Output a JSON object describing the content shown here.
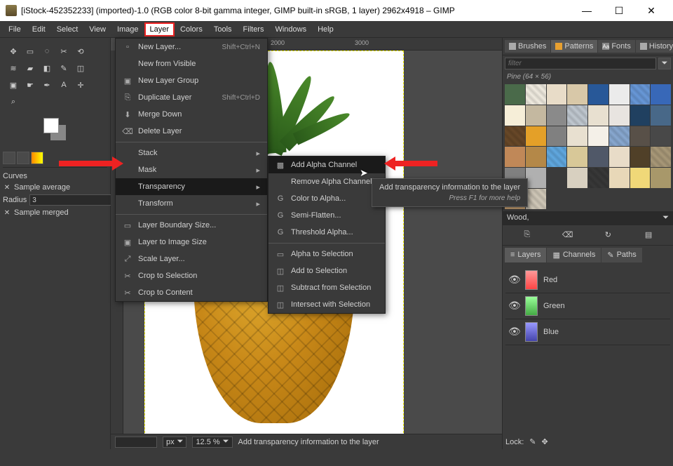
{
  "window": {
    "title": "[iStock-452352233] (imported)-1.0 (RGB color 8-bit gamma integer, GIMP built-in sRGB, 1 layer) 2962x4918 – GIMP"
  },
  "menubar": [
    "File",
    "Edit",
    "Select",
    "View",
    "Image",
    "Layer",
    "Colors",
    "Tools",
    "Filters",
    "Windows",
    "Help"
  ],
  "active_menu_index": 5,
  "layer_menu": {
    "new_layer": "New Layer...",
    "new_layer_sc": "Shift+Ctrl+N",
    "new_from_visible": "New from Visible",
    "new_group": "New Layer Group",
    "duplicate": "Duplicate Layer",
    "duplicate_sc": "Shift+Ctrl+D",
    "merge_down": "Merge Down",
    "delete": "Delete Layer",
    "stack": "Stack",
    "mask": "Mask",
    "transparency": "Transparency",
    "transform": "Transform",
    "boundary": "Layer Boundary Size...",
    "to_image": "Layer to Image Size",
    "scale": "Scale Layer...",
    "crop_sel": "Crop to Selection",
    "crop_content": "Crop to Content"
  },
  "transparency_menu": {
    "add_alpha": "Add Alpha Channel",
    "remove_alpha": "Remove Alpha Channel",
    "color_to_alpha": "Color to Alpha...",
    "semi_flatten": "Semi-Flatten...",
    "threshold": "Threshold Alpha...",
    "alpha_to_sel": "Alpha to Selection",
    "add_to_sel": "Add to Selection",
    "sub_from_sel": "Subtract from Selection",
    "intersect": "Intersect with Selection"
  },
  "tooltip": {
    "text": "Add transparency information to the layer",
    "help": "Press F1 for more help"
  },
  "left_panel": {
    "curves": "Curves",
    "sample_avg": "Sample average",
    "radius": "Radius",
    "radius_val": "3",
    "sample_merged": "Sample merged"
  },
  "ruler": {
    "t1": "2000",
    "t2": "3000"
  },
  "status": {
    "unit": "px",
    "zoom": "12.5 %",
    "msg": "Add transparency information to the layer"
  },
  "right": {
    "tabs": {
      "brushes": "Brushes",
      "patterns": "Patterns",
      "fonts": "Fonts",
      "history": "History"
    },
    "filter_ph": "filter",
    "pattern_size": "Pine (64 × 56)",
    "selected": "Wood,",
    "tabs2": {
      "layers": "Layers",
      "channels": "Channels",
      "paths": "Paths"
    },
    "layers": [
      "Red",
      "Green",
      "Blue"
    ],
    "lock": "Lock:"
  },
  "pattern_colors": [
    "#4a6a4a",
    "#f0ebe0",
    "#e8dcc8",
    "#d8c8a8",
    "#285898",
    "#ebebeb",
    "#6898d8",
    "#3868b8",
    "#f6eed8",
    "#c4b8a0",
    "#8a8a8a",
    "#c0c8d0",
    "#e8e0d0",
    "#e8e4e0",
    "#204060",
    "#486888",
    "#684828",
    "#e4a028",
    "#808080",
    "#e8e0d0",
    "#f4f0e8",
    "#88a8d0",
    "#585048",
    "#484848",
    "#c08858",
    "#b48848",
    "#60a8e0",
    "#d8c898",
    "#505868",
    "#e8dcc8",
    "#504028",
    "#a89878",
    "#808080",
    "#b0b0b0",
    "#3a3a3a",
    "#d8d0c0",
    "#383838",
    "#e8d8b8",
    "#f0d878",
    "#a8986a",
    "#d0a878",
    "#d0c8b8"
  ],
  "layer_thumbs": [
    "linear-gradient(#f99,#f44)",
    "linear-gradient(#9f9,#4a4)",
    "linear-gradient(#99f,#44a)"
  ]
}
